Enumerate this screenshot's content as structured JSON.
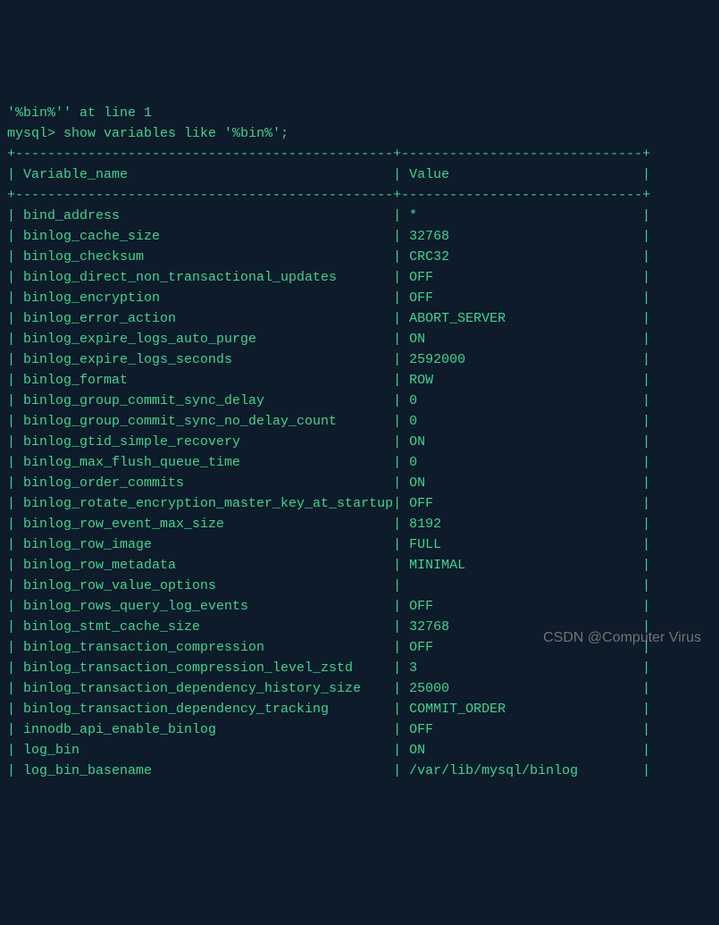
{
  "terminal": {
    "error_line": "'%bin%'' at line 1",
    "prompt": "mysql>",
    "command": "show variables like '%bin%';",
    "header_separator": "+-----------------------------------------------+------------------------------+",
    "col1_header": "Variable_name",
    "col2_header": "Value",
    "rows": [
      {
        "name": "bind_address",
        "value": "*"
      },
      {
        "name": "binlog_cache_size",
        "value": "32768"
      },
      {
        "name": "binlog_checksum",
        "value": "CRC32"
      },
      {
        "name": "binlog_direct_non_transactional_updates",
        "value": "OFF"
      },
      {
        "name": "binlog_encryption",
        "value": "OFF"
      },
      {
        "name": "binlog_error_action",
        "value": "ABORT_SERVER"
      },
      {
        "name": "binlog_expire_logs_auto_purge",
        "value": "ON"
      },
      {
        "name": "binlog_expire_logs_seconds",
        "value": "2592000"
      },
      {
        "name": "binlog_format",
        "value": "ROW"
      },
      {
        "name": "binlog_group_commit_sync_delay",
        "value": "0"
      },
      {
        "name": "binlog_group_commit_sync_no_delay_count",
        "value": "0"
      },
      {
        "name": "binlog_gtid_simple_recovery",
        "value": "ON"
      },
      {
        "name": "binlog_max_flush_queue_time",
        "value": "0"
      },
      {
        "name": "binlog_order_commits",
        "value": "ON"
      },
      {
        "name": "binlog_rotate_encryption_master_key_at_startup",
        "value": "OFF"
      },
      {
        "name": "binlog_row_event_max_size",
        "value": "8192"
      },
      {
        "name": "binlog_row_image",
        "value": "FULL"
      },
      {
        "name": "binlog_row_metadata",
        "value": "MINIMAL"
      },
      {
        "name": "binlog_row_value_options",
        "value": ""
      },
      {
        "name": "binlog_rows_query_log_events",
        "value": "OFF"
      },
      {
        "name": "binlog_stmt_cache_size",
        "value": "32768"
      },
      {
        "name": "binlog_transaction_compression",
        "value": "OFF"
      },
      {
        "name": "binlog_transaction_compression_level_zstd",
        "value": "3"
      },
      {
        "name": "binlog_transaction_dependency_history_size",
        "value": "25000"
      },
      {
        "name": "binlog_transaction_dependency_tracking",
        "value": "COMMIT_ORDER"
      },
      {
        "name": "innodb_api_enable_binlog",
        "value": "OFF"
      },
      {
        "name": "log_bin",
        "value": "ON"
      },
      {
        "name": "log_bin_basename",
        "value": "/var/lib/mysql/binlog"
      }
    ],
    "watermark": "CSDN @Computer Virus"
  }
}
